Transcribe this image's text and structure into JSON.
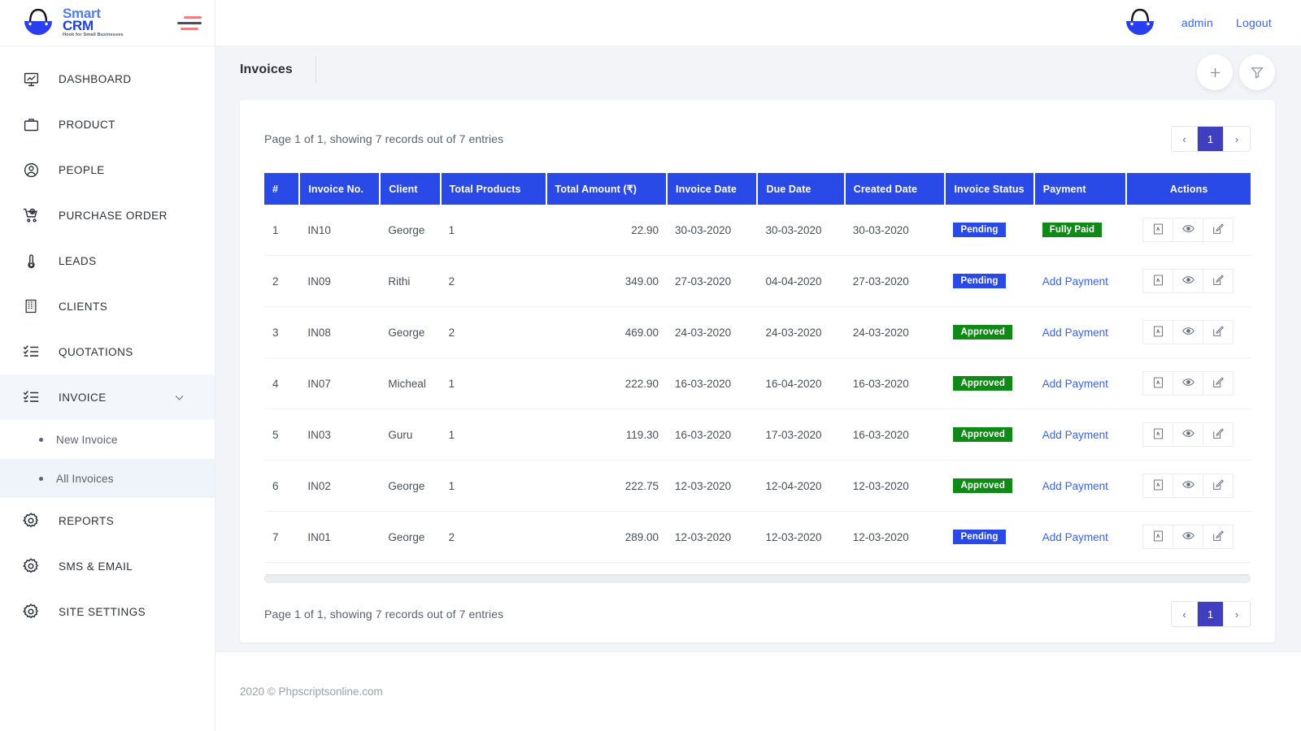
{
  "brand": {
    "name_line1": "Smart",
    "name_line2": "CRM",
    "tagline": "Hook for Small Businesses",
    "colors": {
      "smart": "#4d7cf3",
      "crm": "#1e3fd8"
    }
  },
  "sidebar": {
    "items": [
      {
        "label": "DASHBOARD",
        "icon": "dashboard-icon"
      },
      {
        "label": "PRODUCT",
        "icon": "briefcase-icon"
      },
      {
        "label": "PEOPLE",
        "icon": "user-circle-icon"
      },
      {
        "label": "PURCHASE ORDER",
        "icon": "cart-icon"
      },
      {
        "label": "LEADS",
        "icon": "thermometer-icon"
      },
      {
        "label": "CLIENTS",
        "icon": "building-icon"
      },
      {
        "label": "QUOTATIONS",
        "icon": "checklist-icon"
      },
      {
        "label": "INVOICE",
        "icon": "checklist-icon",
        "expanded": true
      },
      {
        "label": "REPORTS",
        "icon": "gear-icon"
      },
      {
        "label": "SMS & EMAIL",
        "icon": "gear-icon"
      },
      {
        "label": "SITE SETTINGS",
        "icon": "gear-icon"
      }
    ],
    "invoice_submenu": [
      {
        "label": "New Invoice",
        "active": false
      },
      {
        "label": "All Invoices",
        "active": true
      }
    ]
  },
  "topbar": {
    "user_label": "admin",
    "logout_label": "Logout"
  },
  "page": {
    "title": "Invoices",
    "add_button": "+",
    "filter_button": "filter-icon"
  },
  "table": {
    "info_top": "Page 1 of 1, showing 7 records out of 7 entries",
    "info_bottom": "Page 1 of 1, showing 7 records out of 7 entries",
    "pagination": {
      "prev": "‹",
      "current": "1",
      "next": "›"
    },
    "columns": [
      "#",
      "Invoice No.",
      "Client",
      "Total Products",
      "Total Amount (₹)",
      "Invoice Date",
      "Due Date",
      "Created Date",
      "Invoice Status",
      "Payment",
      "Actions"
    ],
    "rows": [
      {
        "n": "1",
        "invoice_no": "IN10",
        "client": "George",
        "total_products": "1",
        "total_amount": "22.90",
        "invoice_date": "30-03-2020",
        "due_date": "30-03-2020",
        "created_date": "30-03-2020",
        "status": "Pending",
        "status_kind": "pending",
        "payment": "Fully Paid",
        "payment_kind": "badge-paid"
      },
      {
        "n": "2",
        "invoice_no": "IN09",
        "client": "Rithi",
        "total_products": "2",
        "total_amount": "349.00",
        "invoice_date": "27-03-2020",
        "due_date": "04-04-2020",
        "created_date": "27-03-2020",
        "status": "Pending",
        "status_kind": "pending",
        "payment": "Add Payment",
        "payment_kind": "link"
      },
      {
        "n": "3",
        "invoice_no": "IN08",
        "client": "George",
        "total_products": "2",
        "total_amount": "469.00",
        "invoice_date": "24-03-2020",
        "due_date": "24-03-2020",
        "created_date": "24-03-2020",
        "status": "Approved",
        "status_kind": "approved",
        "payment": "Add Payment",
        "payment_kind": "link"
      },
      {
        "n": "4",
        "invoice_no": "IN07",
        "client": "Micheal",
        "total_products": "1",
        "total_amount": "222.90",
        "invoice_date": "16-03-2020",
        "due_date": "16-04-2020",
        "created_date": "16-03-2020",
        "status": "Approved",
        "status_kind": "approved",
        "payment": "Add Payment",
        "payment_kind": "link"
      },
      {
        "n": "5",
        "invoice_no": "IN03",
        "client": "Guru",
        "total_products": "1",
        "total_amount": "119.30",
        "invoice_date": "16-03-2020",
        "due_date": "17-03-2020",
        "created_date": "16-03-2020",
        "status": "Approved",
        "status_kind": "approved",
        "payment": "Add Payment",
        "payment_kind": "link"
      },
      {
        "n": "6",
        "invoice_no": "IN02",
        "client": "George",
        "total_products": "1",
        "total_amount": "222.75",
        "invoice_date": "12-03-2020",
        "due_date": "12-04-2020",
        "created_date": "12-03-2020",
        "status": "Approved",
        "status_kind": "approved",
        "payment": "Add Payment",
        "payment_kind": "link"
      },
      {
        "n": "7",
        "invoice_no": "IN01",
        "client": "George",
        "total_products": "2",
        "total_amount": "289.00",
        "invoice_date": "12-03-2020",
        "due_date": "12-03-2020",
        "created_date": "12-03-2020",
        "status": "Pending",
        "status_kind": "pending",
        "payment": "Add Payment",
        "payment_kind": "link"
      }
    ],
    "row_actions": [
      "pdf-icon",
      "eye-icon",
      "edit-icon"
    ]
  },
  "footer": {
    "text": "2020 © Phpscriptsonline.com"
  },
  "colors": {
    "header_blue": "#2a4ae8",
    "badge_green": "#0f8a16",
    "link_blue": "#3b62e8",
    "pager_active": "#3f3fc0"
  }
}
